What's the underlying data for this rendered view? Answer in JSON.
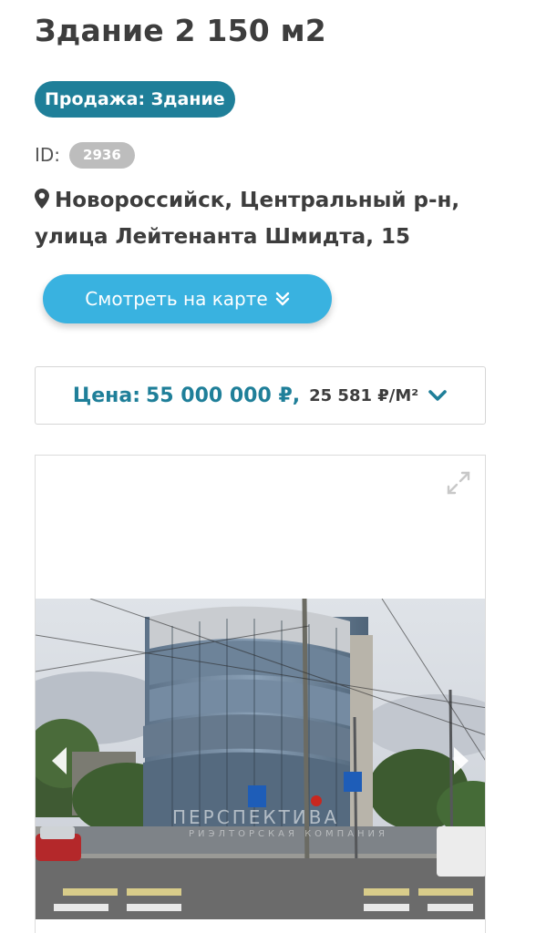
{
  "listing": {
    "title": "Здание 2 150 м2",
    "type_badge": "Продажа: Здание",
    "id_label": "ID:",
    "id_value": "2936",
    "address": "Новороссийск, Центральный р-н, улица Лейтенанта Шмидта, 15"
  },
  "map_button": {
    "label": "Смотреть на карте",
    "icon": "chevron-double-down-icon"
  },
  "price": {
    "label": "Цена:",
    "value": "55 000 000 ₽",
    "separator": ",",
    "per_unit": "25 581 ₽/М²",
    "icon": "chevron-down-icon"
  },
  "gallery": {
    "watermark": "ПЕРСПЕКТИВА",
    "watermark_sub": "РИЭЛТОРСКАЯ КОМПАНИЯ",
    "icons": [
      "expand-icon",
      "arrow-left-icon",
      "arrow-right-icon"
    ]
  },
  "colors": {
    "accent": "#1f7f99",
    "button": "#39b2e0",
    "badge_gray": "#bdbdbd"
  }
}
